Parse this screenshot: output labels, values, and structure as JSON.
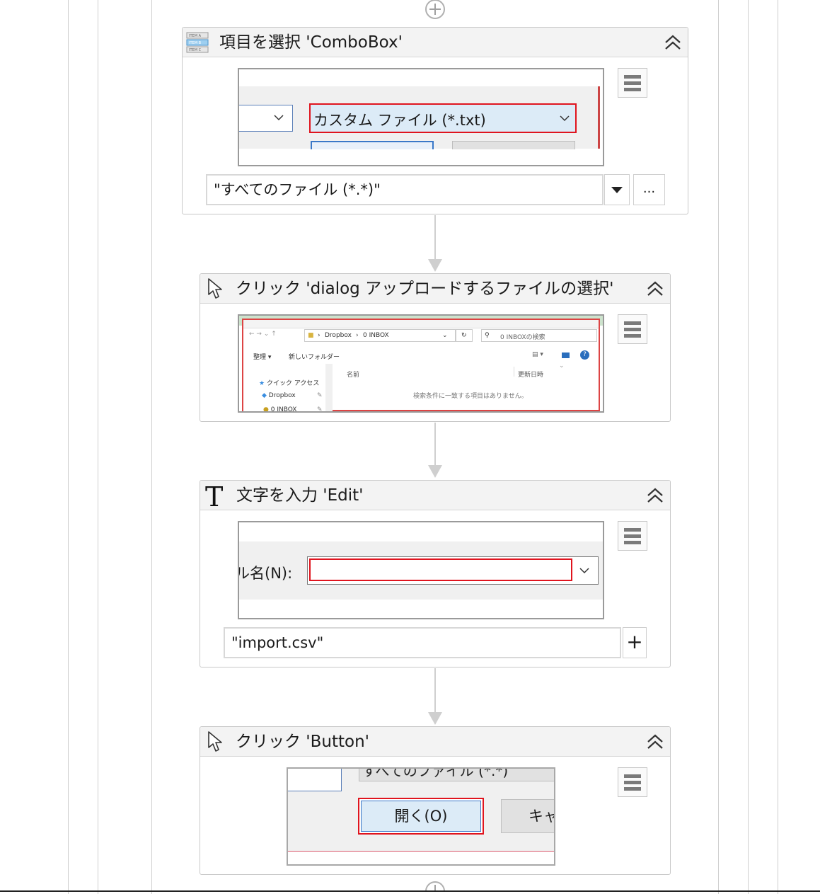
{
  "activities": [
    {
      "title": "項目を選択 'ComboBox'",
      "icon": "combobox-select-icon",
      "screenshot": {
        "combo_text": "カスタム ファイル (*.txt)"
      },
      "property_value": "\"すべてのファイル (*.*)\"",
      "more_button_label": "..."
    },
    {
      "title": "クリック 'dialog  アップロードするファイルの選択'",
      "icon": "cursor-click-icon",
      "screenshot": {
        "breadcrumb_1": "Dropbox",
        "breadcrumb_2": "0 INBOX",
        "search_placeholder": "0 INBOXの検索",
        "toolbar_organize": "整理 ▾",
        "toolbar_new_folder": "新しいフォルダー",
        "column_name": "名前",
        "column_modified": "更新日時",
        "nav_quick_access": "クイック アクセス",
        "nav_dropbox": "Dropbox",
        "nav_inbox": "0 INBOX",
        "empty_message": "検索条件に一致する項目はありません。"
      }
    },
    {
      "title": "文字を入力 'Edit'",
      "icon": "type-text-icon",
      "screenshot": {
        "field_label": "ル名(N):"
      },
      "property_value": "\"import.csv\"",
      "plus_button_label": "+"
    },
    {
      "title": "クリック 'Button'",
      "icon": "cursor-click-icon",
      "screenshot": {
        "partial_combo_text": "すべてのファイル (*.*)",
        "open_button": "開く(O)",
        "cancel_button_partial": "キャ"
      }
    }
  ],
  "colors": {
    "highlight_red": "#e0141e",
    "selection_blue": "#dcebf7",
    "connector_gray": "#cfcfcf"
  }
}
